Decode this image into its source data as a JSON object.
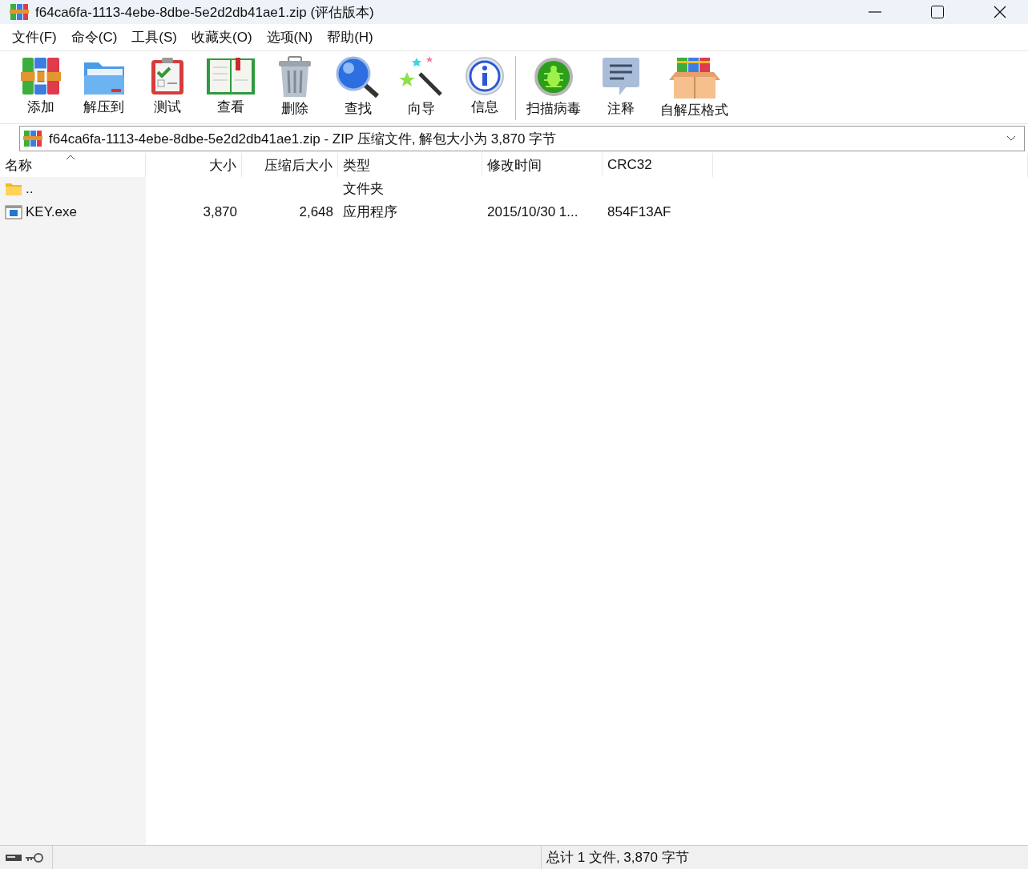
{
  "window": {
    "title": "f64ca6fa-1113-4ebe-8dbe-5e2d2db41ae1.zip (评估版本)"
  },
  "menu": [
    "文件(F)",
    "命令(C)",
    "工具(S)",
    "收藏夹(O)",
    "选项(N)",
    "帮助(H)"
  ],
  "toolbar": [
    {
      "label": "添加"
    },
    {
      "label": "解压到"
    },
    {
      "label": "测试"
    },
    {
      "label": "查看"
    },
    {
      "label": "删除"
    },
    {
      "label": "查找"
    },
    {
      "label": "向导"
    },
    {
      "label": "信息"
    },
    {
      "label": "扫描病毒"
    },
    {
      "label": "注释"
    },
    {
      "label": "自解压格式"
    }
  ],
  "address": {
    "value": "f64ca6fa-1113-4ebe-8dbe-5e2d2db41ae1.zip - ZIP 压缩文件, 解包大小为 3,870 字节"
  },
  "table": {
    "columns": [
      "名称",
      "大小",
      "压缩后大小",
      "类型",
      "修改时间",
      "CRC32"
    ],
    "rows": [
      {
        "kind": "folder",
        "name": "..",
        "type": "文件夹"
      },
      {
        "kind": "exe",
        "name": "KEY.exe",
        "size": "3,870",
        "packed": "2,648",
        "type": "应用程序",
        "modified": "2015/10/30 1...",
        "crc": "854F13AF"
      }
    ]
  },
  "status_bar": {
    "text": "总计 1 文件, 3,870 字节"
  }
}
